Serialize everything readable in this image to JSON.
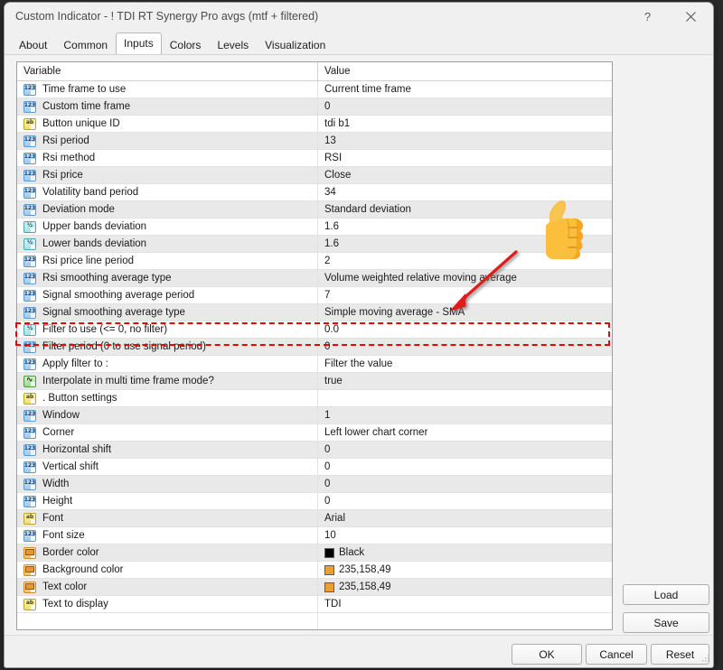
{
  "window": {
    "title": "Custom Indicator - ! TDI RT Synergy Pro avgs  (mtf + filtered)",
    "help_label": "?",
    "close_label": "✕"
  },
  "tabs": [
    {
      "label": "About",
      "selected": false
    },
    {
      "label": "Common",
      "selected": false
    },
    {
      "label": "Inputs",
      "selected": true
    },
    {
      "label": "Colors",
      "selected": false
    },
    {
      "label": "Levels",
      "selected": false
    },
    {
      "label": "Visualization",
      "selected": false
    }
  ],
  "grid": {
    "headers": {
      "variable": "Variable",
      "value": "Value"
    },
    "rows": [
      {
        "icon": "int-icon",
        "variable": "Time frame to use",
        "value": "Current time frame"
      },
      {
        "icon": "int-icon",
        "variable": "Custom time frame",
        "value": "0"
      },
      {
        "icon": "string-icon",
        "variable": "Button unique ID",
        "value": "tdi b1"
      },
      {
        "icon": "int-icon",
        "variable": "Rsi period",
        "value": "13"
      },
      {
        "icon": "int-icon",
        "variable": "Rsi method",
        "value": "RSI"
      },
      {
        "icon": "int-icon",
        "variable": "Rsi price",
        "value": "Close"
      },
      {
        "icon": "int-icon",
        "variable": "Volatility band period",
        "value": "34"
      },
      {
        "icon": "int-icon",
        "variable": "Deviation mode",
        "value": "Standard deviation"
      },
      {
        "icon": "double-icon",
        "variable": "Upper bands deviation",
        "value": "1.6"
      },
      {
        "icon": "double-icon",
        "variable": "Lower bands deviation",
        "value": "1.6"
      },
      {
        "icon": "int-icon",
        "variable": "Rsi price line period",
        "value": "2"
      },
      {
        "icon": "int-icon",
        "variable": "Rsi smoothing average type",
        "value": "Volume weighted relative moving average"
      },
      {
        "icon": "int-icon",
        "variable": "Signal smoothing average period",
        "value": "7"
      },
      {
        "icon": "int-icon",
        "variable": "Signal smoothing average type",
        "value": "Simple moving average - SMA"
      },
      {
        "icon": "double-icon",
        "variable": "Filter to use (<= 0, no filter)",
        "value": "0.0"
      },
      {
        "icon": "int-icon",
        "variable": "Filter period (0 to use signal period)",
        "value": "0"
      },
      {
        "icon": "int-icon",
        "variable": "Apply filter to :",
        "value": "Filter the value"
      },
      {
        "icon": "bool-icon",
        "variable": "Interpolate in multi time frame mode?",
        "value": "true"
      },
      {
        "icon": "string-icon",
        "variable": ". Button settings",
        "value": ""
      },
      {
        "icon": "int-icon",
        "variable": "Window",
        "value": "1"
      },
      {
        "icon": "int-icon",
        "variable": "Corner",
        "value": "Left lower chart corner"
      },
      {
        "icon": "int-icon",
        "variable": "Horizontal shift",
        "value": "0"
      },
      {
        "icon": "int-icon",
        "variable": "Vertical shift",
        "value": "0"
      },
      {
        "icon": "int-icon",
        "variable": "Width",
        "value": "0"
      },
      {
        "icon": "int-icon",
        "variable": "Height",
        "value": "0"
      },
      {
        "icon": "string-icon",
        "variable": "Font",
        "value": "Arial"
      },
      {
        "icon": "int-icon",
        "variable": "Font size",
        "value": "10"
      },
      {
        "icon": "color-icon",
        "variable": "Border color",
        "value": "Black",
        "swatch": "#000000"
      },
      {
        "icon": "color-icon",
        "variable": "Background color",
        "value": "235,158,49",
        "swatch": "#EB9E31"
      },
      {
        "icon": "color-icon",
        "variable": "Text color",
        "value": "235,158,49",
        "swatch": "#EB9E31"
      },
      {
        "icon": "string-icon",
        "variable": "Text to display",
        "value": "TDI"
      }
    ]
  },
  "side_buttons": {
    "load": "Load",
    "save": "Save"
  },
  "footer_buttons": {
    "ok": "OK",
    "cancel": "Cancel",
    "reset": "Reset"
  },
  "annotations": {
    "highlight_color": "#EE0000",
    "highlight_target_row": "Rsi smoothing average type",
    "arrow_color": "#E01B1B",
    "emoji": "👍"
  },
  "icon_glyphs": {
    "int-icon": "123",
    "double-icon": "½",
    "string-icon": "ab",
    "bool-icon": "∿",
    "color-icon": ""
  }
}
